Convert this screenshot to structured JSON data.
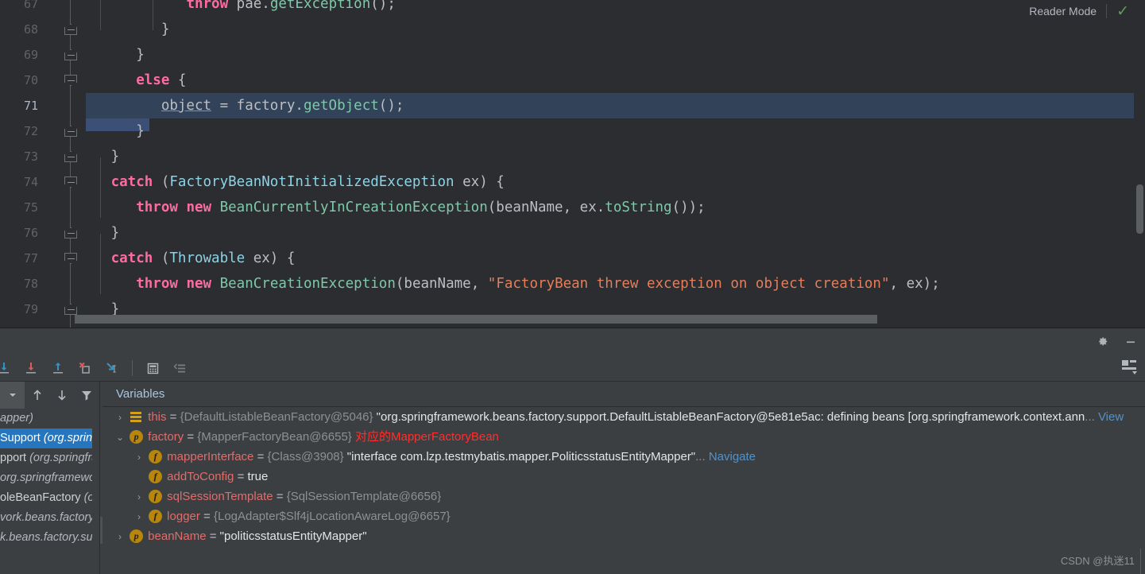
{
  "editor": {
    "reader_mode_label": "Reader Mode",
    "check_icon": "check-icon",
    "line_numbers": [
      "67",
      "68",
      "69",
      "70",
      "71",
      "72",
      "73",
      "74",
      "75",
      "76",
      "77",
      "78",
      "79"
    ],
    "active_line": "71",
    "lines": [
      {
        "num": "67",
        "indent": 0,
        "tokens": [
          {
            "t": "            ",
            "c": "id"
          },
          {
            "t": "throw",
            "c": "kw"
          },
          {
            "t": " pae.",
            "c": "id"
          },
          {
            "t": "getException",
            "c": "cl"
          },
          {
            "t": "();",
            "c": "id"
          }
        ]
      },
      {
        "num": "68",
        "indent": 0,
        "tokens": [
          {
            "t": "         }",
            "c": "id"
          }
        ]
      },
      {
        "num": "69",
        "indent": 0,
        "tokens": [
          {
            "t": "      }",
            "c": "id"
          }
        ]
      },
      {
        "num": "70",
        "indent": 0,
        "tokens": [
          {
            "t": "      ",
            "c": "id"
          },
          {
            "t": "else",
            "c": "kw"
          },
          {
            "t": " {",
            "c": "id"
          }
        ]
      },
      {
        "num": "71",
        "indent": 0,
        "highlight": true,
        "tokens": [
          {
            "t": "         ",
            "c": "id"
          },
          {
            "t": "object",
            "c": "ul"
          },
          {
            "t": " = factory.",
            "c": "id"
          },
          {
            "t": "getObject",
            "c": "cl"
          },
          {
            "t": "();",
            "c": "id"
          }
        ]
      },
      {
        "num": "72",
        "indent": 0,
        "tokens": [
          {
            "t": "      }",
            "c": "id"
          }
        ]
      },
      {
        "num": "73",
        "indent": 0,
        "tokens": [
          {
            "t": "   }",
            "c": "id"
          }
        ]
      },
      {
        "num": "74",
        "indent": 0,
        "tokens": [
          {
            "t": "   ",
            "c": "id"
          },
          {
            "t": "catch",
            "c": "kw"
          },
          {
            "t": " (",
            "c": "id"
          },
          {
            "t": "FactoryBeanNotInitializedException",
            "c": "ty"
          },
          {
            "t": " ex) {",
            "c": "id"
          }
        ]
      },
      {
        "num": "75",
        "indent": 0,
        "tokens": [
          {
            "t": "      ",
            "c": "id"
          },
          {
            "t": "throw",
            "c": "kw"
          },
          {
            "t": " ",
            "c": "id"
          },
          {
            "t": "new",
            "c": "kw"
          },
          {
            "t": " ",
            "c": "id"
          },
          {
            "t": "BeanCurrentlyInCreationException",
            "c": "cl"
          },
          {
            "t": "(beanName, ex.",
            "c": "id"
          },
          {
            "t": "toString",
            "c": "cl"
          },
          {
            "t": "());",
            "c": "id"
          }
        ]
      },
      {
        "num": "76",
        "indent": 0,
        "tokens": [
          {
            "t": "   }",
            "c": "id"
          }
        ]
      },
      {
        "num": "77",
        "indent": 0,
        "tokens": [
          {
            "t": "   ",
            "c": "id"
          },
          {
            "t": "catch",
            "c": "kw"
          },
          {
            "t": " (",
            "c": "id"
          },
          {
            "t": "Throwable",
            "c": "ty"
          },
          {
            "t": " ex) {",
            "c": "id"
          }
        ]
      },
      {
        "num": "78",
        "indent": 0,
        "tokens": [
          {
            "t": "      ",
            "c": "id"
          },
          {
            "t": "throw",
            "c": "kw"
          },
          {
            "t": " ",
            "c": "id"
          },
          {
            "t": "new",
            "c": "kw"
          },
          {
            "t": " ",
            "c": "id"
          },
          {
            "t": "BeanCreationException",
            "c": "cl"
          },
          {
            "t": "(beanName, ",
            "c": "id"
          },
          {
            "t": "\"FactoryBean threw exception on object creation\"",
            "c": "st"
          },
          {
            "t": ", ex);",
            "c": "id"
          }
        ]
      },
      {
        "num": "79",
        "indent": 0,
        "tokens": [
          {
            "t": "   }",
            "c": "id"
          }
        ]
      }
    ]
  },
  "tool_header": {
    "settings_icon": "gear-icon",
    "minimize_icon": "minimize-icon"
  },
  "toolbar": {
    "buttons": [
      {
        "name": "step-over-button",
        "icon": "step-over-icon"
      },
      {
        "name": "step-into-button",
        "icon": "arrow-down-icon"
      },
      {
        "name": "force-step-into-button",
        "icon": "arrow-down-red-icon"
      },
      {
        "name": "step-out-button",
        "icon": "arrow-up-icon"
      },
      {
        "name": "drop-frame-button",
        "icon": "drop-frame-icon"
      },
      {
        "name": "run-to-cursor-button",
        "icon": "run-to-cursor-icon"
      },
      {
        "name": "evaluate-expression-button",
        "icon": "calculator-icon"
      },
      {
        "name": "show-execution-point-button",
        "icon": "align-lines-icon"
      }
    ],
    "layout_icon": "layout-settings-icon"
  },
  "frames": {
    "toolbar": [
      {
        "name": "thread-selector",
        "icon": "chevron-down-icon"
      },
      {
        "name": "frame-up-button",
        "icon": "arrow-up-icon"
      },
      {
        "name": "frame-down-button",
        "icon": "arrow-down-icon"
      },
      {
        "name": "filter-frames-button",
        "icon": "funnel-icon"
      }
    ],
    "items": [
      {
        "main": "",
        "pkg": "apper)",
        "selected": false
      },
      {
        "main": "Support",
        "pkg": "(org.spring",
        "selected": true
      },
      {
        "main": "pport",
        "pkg": "(org.springfra",
        "selected": false
      },
      {
        "main": "",
        "pkg": "org.springframewor",
        "selected": false
      },
      {
        "main": "oleBeanFactory",
        "pkg": "(or",
        "selected": false
      },
      {
        "main": "",
        "pkg": "vork.beans.factory.s",
        "selected": false
      },
      {
        "main": "",
        "pkg": "k.beans.factory.sup",
        "selected": false
      }
    ]
  },
  "rail": {
    "buttons": [
      {
        "name": "add-watch-button",
        "icon": "plus-icon"
      },
      {
        "name": "remove-watch-button",
        "icon": "minus-icon"
      },
      {
        "name": "move-up-button",
        "icon": "triangle-up-icon"
      },
      {
        "name": "move-down-button",
        "icon": "triangle-down-icon"
      },
      {
        "name": "copy-value-button",
        "icon": "copy-icon"
      },
      {
        "name": "inspect-button",
        "icon": "glasses-icon"
      }
    ]
  },
  "variables": {
    "title": "Variables",
    "rows": [
      {
        "indent": 0,
        "arrow": "›",
        "icon": "lines",
        "name": "this",
        "eq": " = ",
        "ref": "{DefaultListableBeanFactory@5046}",
        "value": " \"org.springframework.beans.factory.support.DefaultListableBeanFactory@5e81e5ac: defining beans [org.springframework.context.ann",
        "ellipsis": "...",
        "link": "View",
        "note": ""
      },
      {
        "indent": 0,
        "arrow": "⌄",
        "icon": "p",
        "name": "factory",
        "eq": " = ",
        "ref": "{MapperFactoryBean@6655}",
        "value": "",
        "ellipsis": "",
        "link": "",
        "note": "对应的MapperFactoryBean"
      },
      {
        "indent": 1,
        "arrow": "›",
        "icon": "f",
        "name": "mapperInterface",
        "eq": " = ",
        "ref": "{Class@3908}",
        "value": " \"interface com.lzp.testmybatis.mapper.PoliticsstatusEntityMapper\"",
        "ellipsis": "...",
        "link": "Navigate",
        "note": ""
      },
      {
        "indent": 1,
        "arrow": "",
        "icon": "f",
        "name": "addToConfig",
        "eq": " = ",
        "ref": "",
        "value": "true",
        "ellipsis": "",
        "link": "",
        "note": ""
      },
      {
        "indent": 1,
        "arrow": "›",
        "icon": "f",
        "name": "sqlSessionTemplate",
        "eq": " = ",
        "ref": "{SqlSessionTemplate@6656}",
        "value": "",
        "ellipsis": "",
        "link": "",
        "note": ""
      },
      {
        "indent": 1,
        "arrow": "›",
        "icon": "f",
        "name": "logger",
        "eq": " = ",
        "ref": "{LogAdapter$Slf4jLocationAwareLog@6657}",
        "value": "",
        "ellipsis": "",
        "link": "",
        "note": ""
      },
      {
        "indent": 0,
        "arrow": "›",
        "icon": "p",
        "name": "beanName",
        "eq": " = ",
        "ref": "",
        "value": "\"politicsstatusEntityMapper\"",
        "ellipsis": "",
        "link": "",
        "note": ""
      }
    ]
  },
  "watermark": {
    "text": "CSDN @执迷11"
  },
  "colors": {
    "editor_bg": "#2b2d30",
    "panel_bg": "#3c3f41",
    "highlight_line": "#314259",
    "selection_blue": "#2675bf",
    "keyword_pink": "#ff6b9d",
    "type_cyan": "#8ad4e8",
    "method_green": "#7fc8a9",
    "string_orange": "#e87d5a",
    "var_red": "#e06c6c",
    "note_red": "#ff2e2e",
    "link_blue": "#5591c8"
  }
}
